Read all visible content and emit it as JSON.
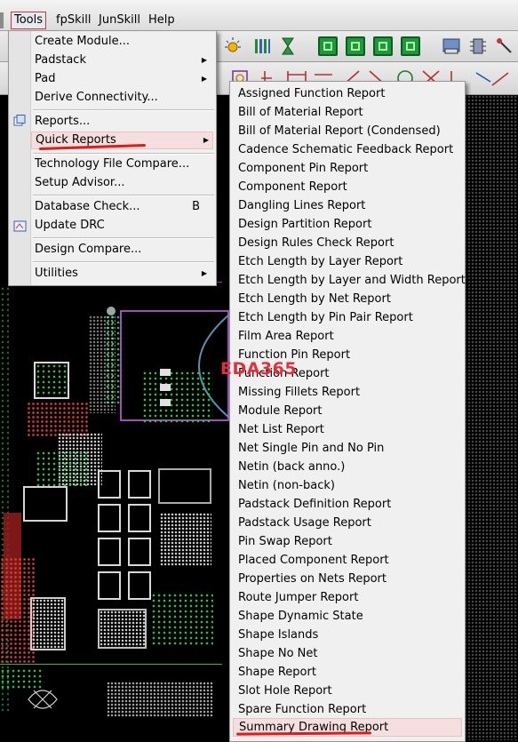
{
  "menubar": {
    "items": [
      "Tools",
      "fpSkill",
      "JunSkill",
      "Help"
    ]
  },
  "tools_menu": {
    "items": [
      {
        "label": "Create Module..."
      },
      {
        "label": "Padstack"
      },
      {
        "label": "Pad"
      },
      {
        "label": "Derive Connectivity..."
      },
      {
        "label": "Reports..."
      },
      {
        "label": "Quick Reports"
      },
      {
        "label": "Technology File Compare..."
      },
      {
        "label": "Setup Advisor..."
      },
      {
        "label": "Database Check...",
        "shortcut": "B"
      },
      {
        "label": "Update DRC"
      },
      {
        "label": "Design Compare..."
      },
      {
        "label": "Utilities"
      }
    ]
  },
  "quick_reports": {
    "items": [
      "Assigned Function Report",
      "Bill of Material Report",
      "Bill of Material Report (Condensed)",
      "Cadence Schematic Feedback Report",
      "Component Pin Report",
      "Component Report",
      "Dangling Lines Report",
      "Design Partition Report",
      "Design Rules Check Report",
      "Etch Length by Layer Report",
      "Etch Length by Layer and Width Report",
      "Etch Length by Net Report",
      "Etch Length by Pin Pair Report",
      "Film Area Report",
      "Function Pin Report",
      "Function Report",
      "Missing Fillets Report",
      "Module Report",
      "Net List Report",
      "Net Single Pin and No Pin",
      "Netin (back anno.)",
      "Netin (non-back)",
      "Padstack Definition Report",
      "Padstack Usage Report",
      "Pin Swap Report",
      "Placed Component Report",
      "Properties on Nets Report",
      "Route Jumper Report",
      "Shape Dynamic State",
      "Shape Islands",
      "Shape No Net",
      "Shape Report",
      "Slot Hole Report",
      "Spare Function Report",
      "Summary Drawing Report"
    ]
  },
  "watermark": "EDA365",
  "icons": {
    "toolbar": [
      "sun-icon",
      "library-icon",
      "hourglass-icon",
      "green-toolbar-icons",
      "odb-icon",
      "component-icon",
      "probe-icon"
    ],
    "submenu_arrow": "triangle-right-icon",
    "reports_icon": "reports-icon",
    "update_drc_icon": "update-drc-icon"
  },
  "colors": {
    "highlight": "#f4dede",
    "annotation_red": "#d81e1e",
    "pcb_background": "#000000",
    "pcb_green": "#2ec14b"
  }
}
